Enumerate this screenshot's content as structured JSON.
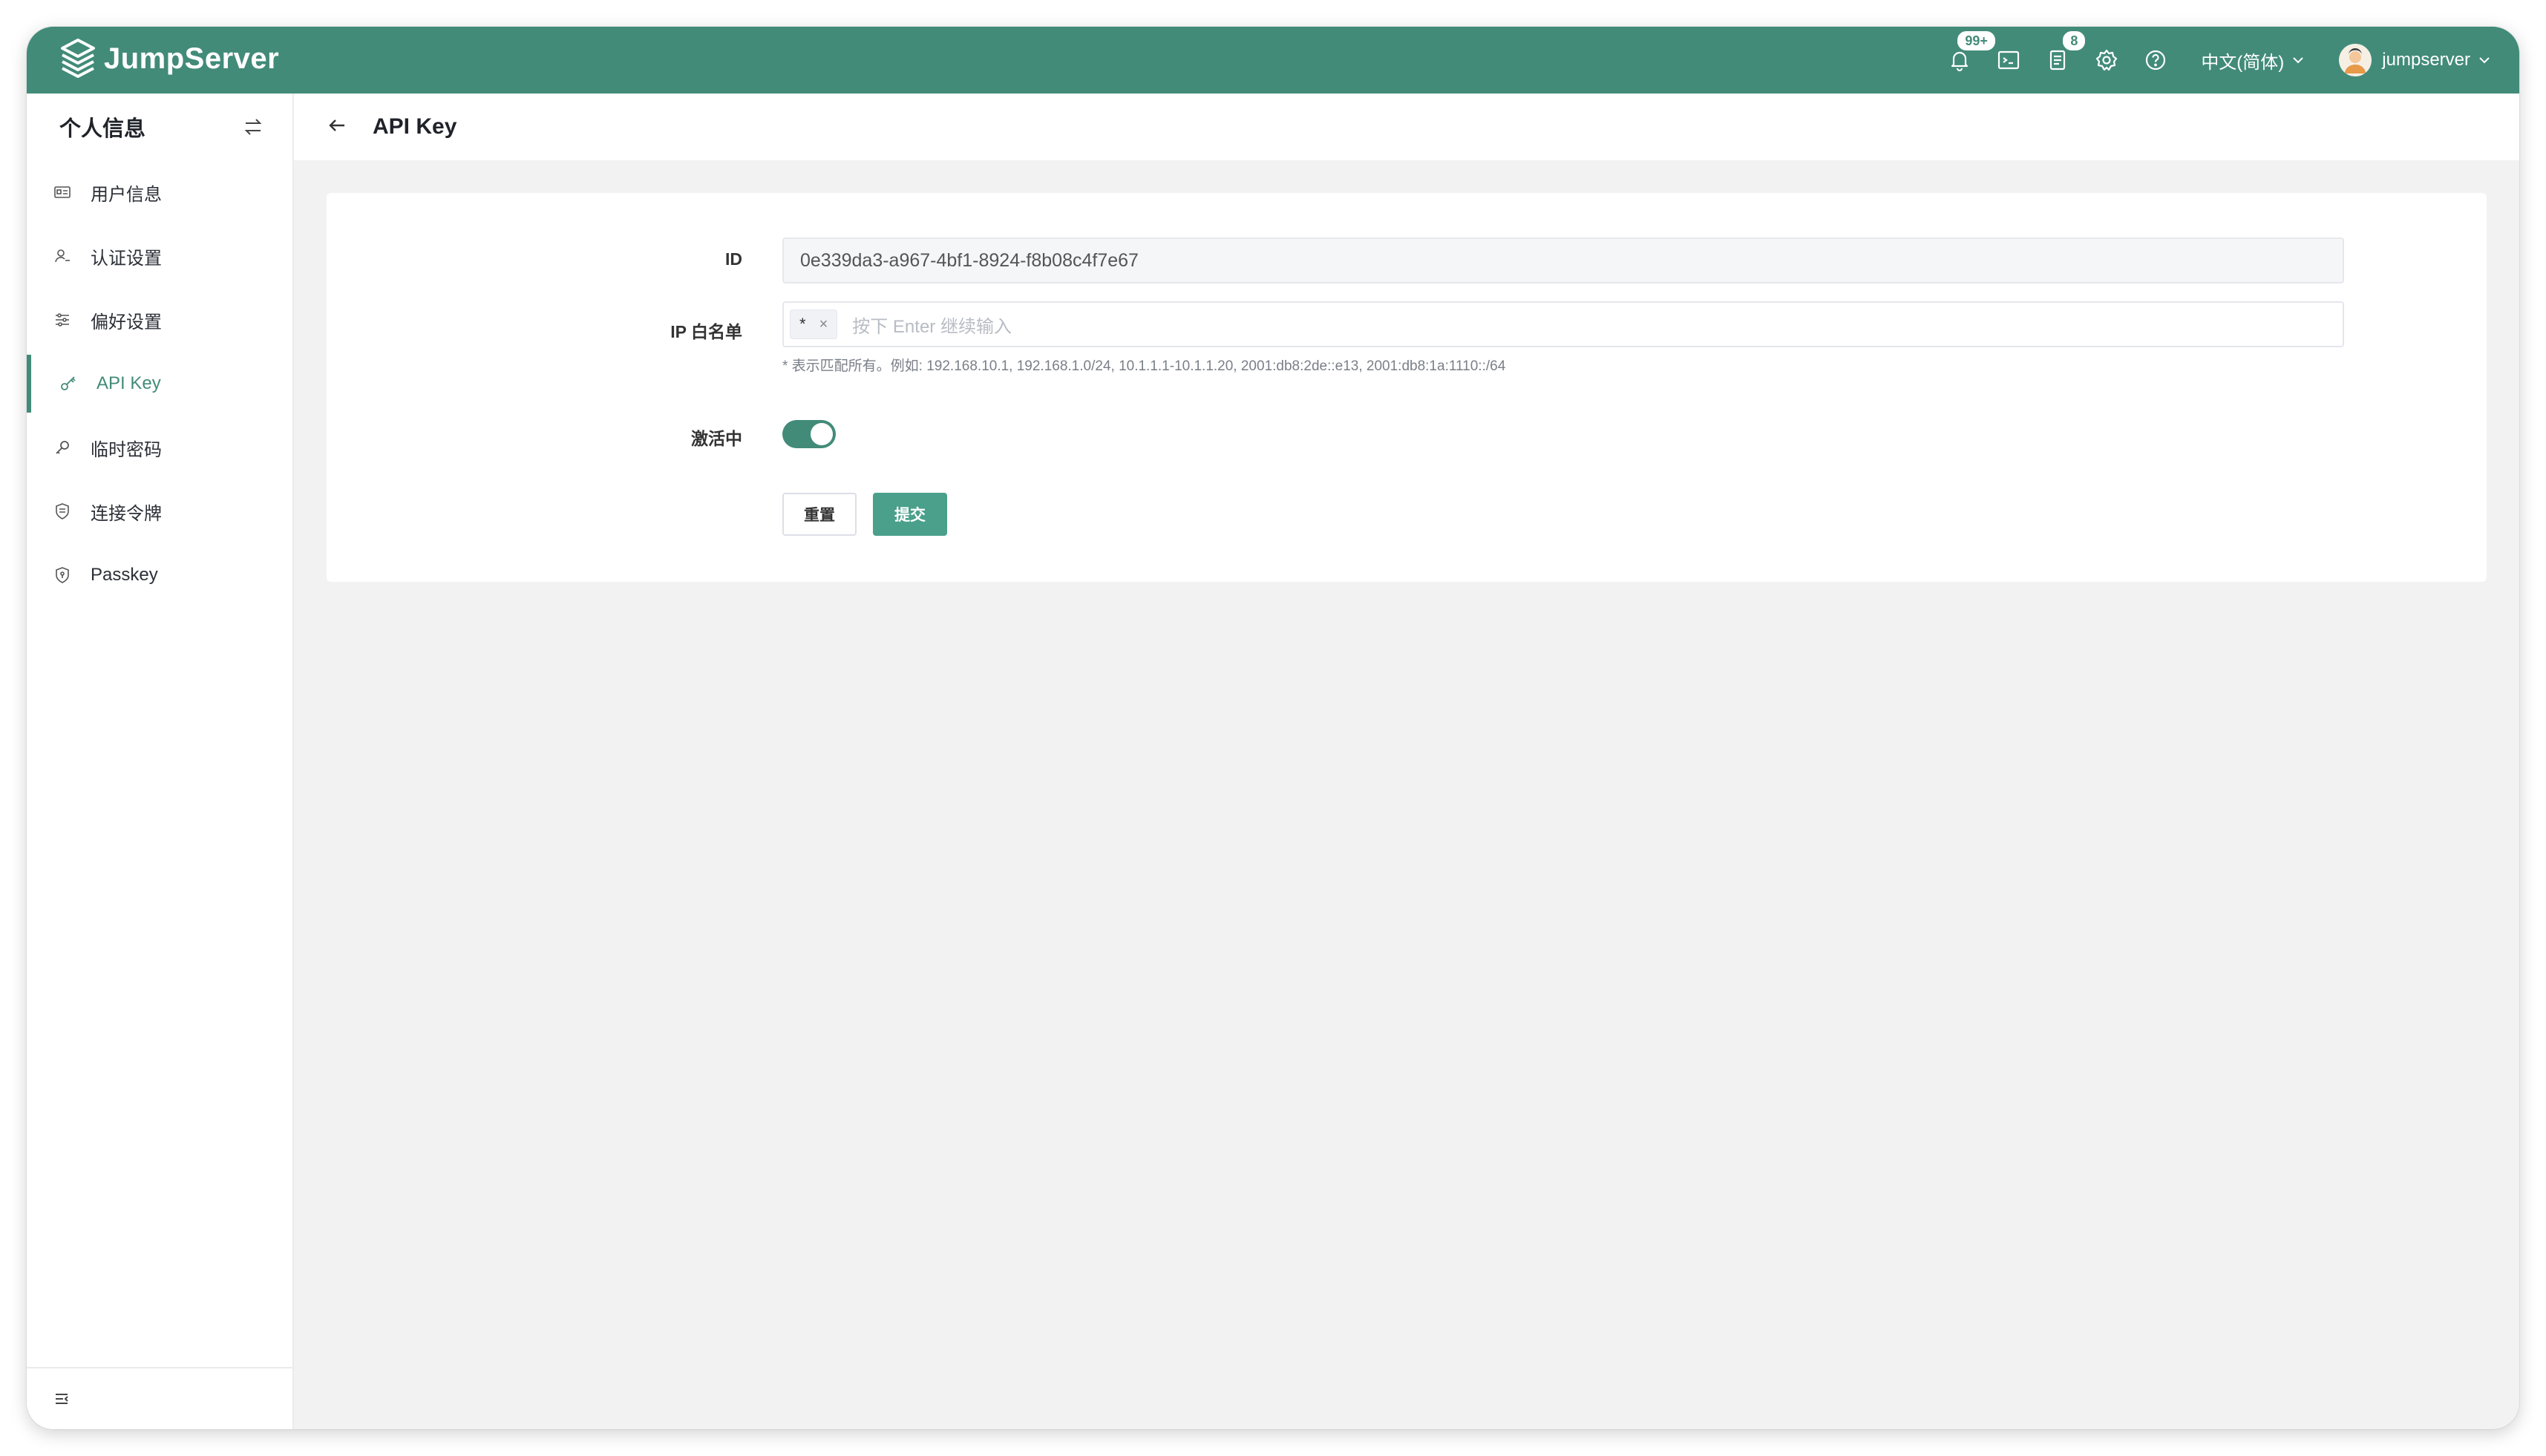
{
  "header": {
    "brand": "JumpServer",
    "notifications_badge": "99+",
    "tickets_badge": "8",
    "language": "中文(简体)",
    "username": "jumpserver",
    "icons": [
      "bell-icon",
      "terminal-icon",
      "document-icon",
      "gear-icon",
      "help-icon"
    ],
    "accent_color": "#428b79"
  },
  "sidebar": {
    "title": "个人信息",
    "items": [
      {
        "label": "用户信息",
        "icon": "id-card-icon",
        "active": false
      },
      {
        "label": "认证设置",
        "icon": "user-settings-icon",
        "active": false
      },
      {
        "label": "偏好设置",
        "icon": "sliders-icon",
        "active": false
      },
      {
        "label": "API Key",
        "icon": "key-icon",
        "active": true
      },
      {
        "label": "临时密码",
        "icon": "temp-key-icon",
        "active": false
      },
      {
        "label": "连接令牌",
        "icon": "token-shield-icon",
        "active": false
      },
      {
        "label": "Passkey",
        "icon": "passkey-shield-icon",
        "active": false
      }
    ]
  },
  "page": {
    "title": "API Key"
  },
  "form": {
    "id_label": "ID",
    "id_value": "0e339da3-a967-4bf1-8924-f8b08c4f7e67",
    "ip_label": "IP 白名单",
    "ip_tag": "*",
    "ip_tag_close": "×",
    "ip_placeholder": "按下 Enter 继续输入",
    "ip_hint": "* 表示匹配所有。例如: 192.168.10.1, 192.168.1.0/24, 10.1.1.1-10.1.1.20, 2001:db8:2de::e13, 2001:db8:1a:1110::/64",
    "active_label": "激活中",
    "active": true,
    "reset_label": "重置",
    "submit_label": "提交"
  }
}
